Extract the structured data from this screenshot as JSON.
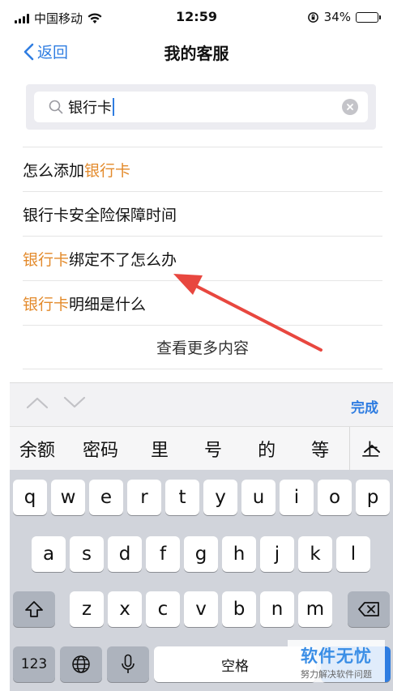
{
  "status_bar": {
    "carrier": "中国移动",
    "time": "12:59",
    "battery": "34%",
    "battery_level": 0.34
  },
  "nav": {
    "back_label": "返回",
    "title": "我的客服"
  },
  "search": {
    "value": "银行卡"
  },
  "results": [
    {
      "prefix": "怎么添加",
      "highlight": "银行卡",
      "suffix": ""
    },
    {
      "prefix": "银行卡安全险保障时间",
      "highlight": "",
      "suffix": ""
    },
    {
      "prefix": "",
      "highlight": "银行卡",
      "suffix": "绑定不了怎么办"
    },
    {
      "prefix": "",
      "highlight": "银行卡",
      "suffix": "明细是什么"
    }
  ],
  "more_label": "查看更多内容",
  "toolbar": {
    "done_label": "完成"
  },
  "candidates": [
    "余额",
    "密码",
    "里",
    "号",
    "的",
    "等",
    "上"
  ],
  "keyboard": {
    "row1": [
      "q",
      "w",
      "e",
      "r",
      "t",
      "y",
      "u",
      "i",
      "o",
      "p"
    ],
    "row2": [
      "a",
      "s",
      "d",
      "f",
      "g",
      "h",
      "j",
      "k",
      "l"
    ],
    "row3": [
      "z",
      "x",
      "c",
      "v",
      "b",
      "n",
      "m"
    ],
    "numbers_label": "123",
    "space_label": "空格"
  },
  "watermark": {
    "title": "软件无忧",
    "subtitle": "努力解决软件问题"
  },
  "colors": {
    "accent": "#2f7de1",
    "highlight": "#e38a2b",
    "annotation_arrow": "#e8473f"
  }
}
